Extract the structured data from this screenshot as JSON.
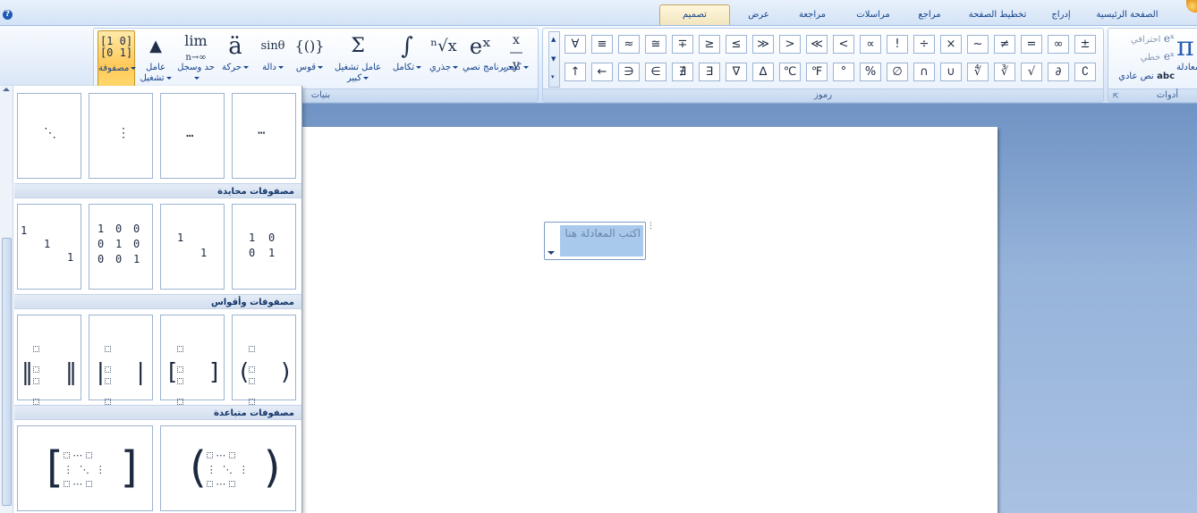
{
  "tabs": [
    {
      "label": "الصفحة الرئيسية",
      "active": false
    },
    {
      "label": "إدراج",
      "active": false
    },
    {
      "label": "تخطيط الصفحة",
      "active": false
    },
    {
      "label": "مراجع",
      "active": false
    },
    {
      "label": "مراسلات",
      "active": false
    },
    {
      "label": "مراجعة",
      "active": false
    },
    {
      "label": "عرض",
      "active": false
    },
    {
      "label": "تصميم",
      "active": true
    }
  ],
  "help_icon": "?",
  "groups": {
    "tools": {
      "label": "أدوات",
      "equation_glyph": "π",
      "equation_label": "معادلة",
      "professional_label": "احترافي",
      "linear_label": "خطي",
      "normal_text_label": "نص عادي",
      "normal_text_glyph": "abc"
    },
    "symbols": {
      "label": "رموز",
      "row1": [
        "±",
        "∞",
        "=",
        "≠",
        "~",
        "×",
        "÷",
        "!",
        "∝",
        "<",
        "≪",
        ">",
        "≫",
        "≤",
        "≥",
        "∓",
        "≅",
        "≈",
        "≡",
        "∀"
      ],
      "row2": [
        "∁",
        "∂",
        "√",
        "∛",
        "∜",
        "∪",
        "∩",
        "∅",
        "%",
        "°",
        "℉",
        "℃",
        "∆",
        "∇",
        "∃",
        "∄",
        "∈",
        "∋",
        "←",
        "↑"
      ]
    },
    "structures": {
      "label": "بنيات",
      "buttons": [
        {
          "glyph": "x/y",
          "label": "كسر"
        },
        {
          "glyph": "eˣ",
          "label": "برنامج نصي"
        },
        {
          "glyph": "ⁿ√x",
          "label": "جذري"
        },
        {
          "glyph": "∫",
          "label": "تكامل"
        },
        {
          "glyph": "Σ",
          "label": "عامل تشغيل كبير"
        },
        {
          "glyph": "{()}",
          "label": "قوس"
        },
        {
          "glyph": "sinθ",
          "label": "دالة"
        },
        {
          "glyph": "ä",
          "label": "حركة"
        },
        {
          "glyph": "lim",
          "label": "حد وسجل"
        },
        {
          "glyph": "▲",
          "label": "عامل تشغيل"
        },
        {
          "glyph": "[10/01]",
          "label": "مصفوفة"
        }
      ]
    }
  },
  "gallery": {
    "dots_row": [
      "⋯",
      "…",
      "⋮",
      "⋱"
    ],
    "identity_header": "مصفوفات محايدة",
    "brackets_header": "مصفوفات وأقواس",
    "sparse_header": "مصفوفات متباعدة",
    "identity": {
      "m2": [
        [
          "1",
          "0"
        ],
        [
          "0",
          "1"
        ]
      ],
      "m2d": [
        [
          "1",
          ""
        ],
        [
          "",
          "1"
        ]
      ],
      "m3": [
        [
          "1",
          "0",
          "0"
        ],
        [
          "0",
          "1",
          "0"
        ],
        [
          "0",
          "0",
          "1"
        ]
      ],
      "m3d": [
        [
          "1",
          "",
          ""
        ],
        [
          "",
          "1",
          ""
        ],
        [
          "",
          "",
          "1"
        ]
      ]
    },
    "sparse_dots": [
      "⋯",
      "⋮",
      "⋱",
      "⋮",
      "⋯"
    ]
  },
  "equation_placeholder": "اكتب المعادلة هنا"
}
